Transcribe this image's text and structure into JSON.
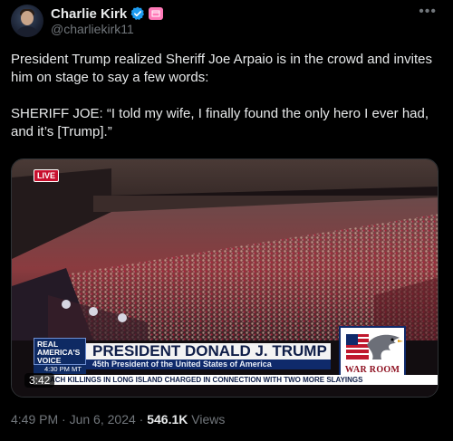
{
  "author": {
    "display_name": "Charlie Kirk",
    "handle": "@charliekirk11"
  },
  "tweet": {
    "paragraph_1": "President Trump realized Sheriff Joe Arpaio is in the crowd and invites him on stage to say a few words:",
    "paragraph_2": "SHERIFF JOE: “I told my wife, I finally found the only hero I ever had, and it’s [Trump].”"
  },
  "video": {
    "live_label": "LIVE",
    "duration": "3:42",
    "chyron_logo": "REAL AMERICA'S VOICE",
    "chyron_time": "4:30 PM MT",
    "chyron_title": "PRESIDENT DONALD J. TRUMP",
    "chyron_subtitle": "45th President of the United States of America",
    "ticker": "ACH KILLINGS IN LONG ISLAND CHARGED IN CONNECTION WITH TWO MORE SLAYINGS",
    "brand_label": "WAR ROOM"
  },
  "meta": {
    "time": "4:49 PM",
    "separator_1": "·",
    "date": "Jun 6, 2024",
    "separator_2": "·",
    "views_count": "546.1K",
    "views_label": "Views"
  },
  "colors": {
    "verified": "#1d9bf0",
    "affiliate": "#ff7ab8",
    "muted_text": "#71767b",
    "live_red": "#c8102e"
  },
  "icons": [
    "verified-badge-icon",
    "affiliate-badge-icon",
    "more-options-icon"
  ]
}
